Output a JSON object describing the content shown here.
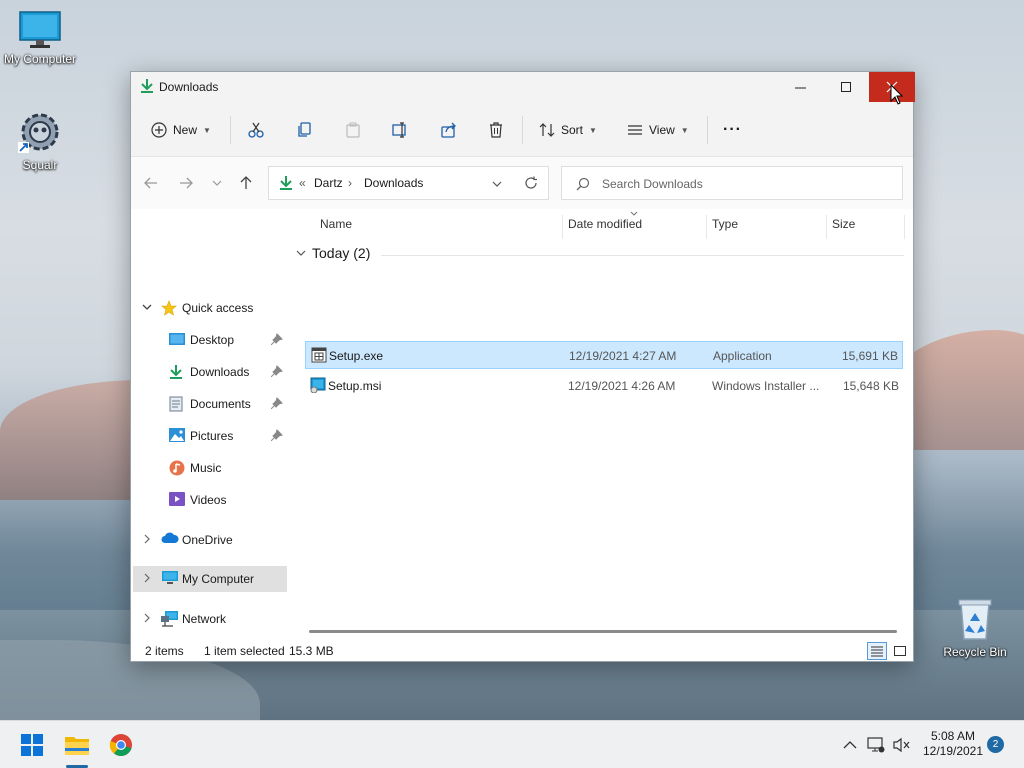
{
  "desktop": {
    "icons": [
      {
        "label": "My Computer"
      },
      {
        "label": "Squalr"
      },
      {
        "label": "Recycle Bin"
      }
    ]
  },
  "window": {
    "title": "Downloads",
    "toolbar": {
      "new_label": "New",
      "sort_label": "Sort",
      "view_label": "View",
      "more_label": "···"
    },
    "address": {
      "overflow": "«",
      "segments": [
        "Dartz",
        "Downloads"
      ]
    },
    "search": {
      "placeholder": "Search Downloads"
    },
    "nav": {
      "quick_access": "Quick access",
      "items": [
        {
          "label": "Desktop"
        },
        {
          "label": "Downloads"
        },
        {
          "label": "Documents"
        },
        {
          "label": "Pictures"
        },
        {
          "label": "Music"
        },
        {
          "label": "Videos"
        }
      ],
      "onedrive": "OneDrive",
      "my_computer": "My Computer",
      "network": "Network"
    },
    "columns": {
      "name": "Name",
      "date": "Date modified",
      "type": "Type",
      "size": "Size"
    },
    "group": {
      "label": "Today (2)"
    },
    "files": [
      {
        "name": "Setup.exe",
        "date": "12/19/2021 4:27 AM",
        "type": "Application",
        "size": "15,691 KB"
      },
      {
        "name": "Setup.msi",
        "date": "12/19/2021 4:26 AM",
        "type": "Windows Installer ...",
        "size": "15,648 KB"
      }
    ],
    "status": {
      "count": "2 items",
      "selected": "1 item selected",
      "size": "15.3 MB"
    }
  },
  "taskbar": {
    "time": "5:08 AM",
    "date": "12/19/2021",
    "notifications": "2"
  },
  "colors": {
    "close_red": "#c42b1c",
    "selection": "#cce8ff",
    "accent_green": "#1e9e5a"
  }
}
